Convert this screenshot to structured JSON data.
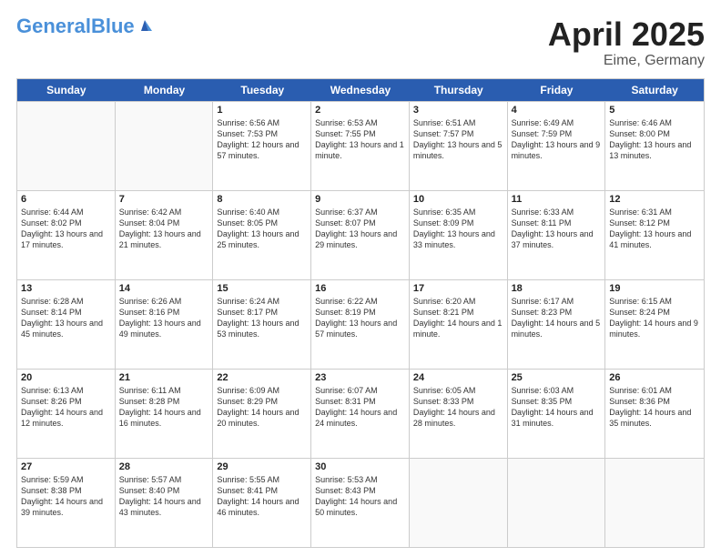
{
  "header": {
    "logo_general": "General",
    "logo_blue": "Blue",
    "title": "April 2025",
    "location": "Eime, Germany"
  },
  "weekdays": [
    "Sunday",
    "Monday",
    "Tuesday",
    "Wednesday",
    "Thursday",
    "Friday",
    "Saturday"
  ],
  "weeks": [
    [
      {
        "day": "",
        "sunrise": "",
        "sunset": "",
        "daylight": ""
      },
      {
        "day": "",
        "sunrise": "",
        "sunset": "",
        "daylight": ""
      },
      {
        "day": "1",
        "sunrise": "Sunrise: 6:56 AM",
        "sunset": "Sunset: 7:53 PM",
        "daylight": "Daylight: 12 hours and 57 minutes."
      },
      {
        "day": "2",
        "sunrise": "Sunrise: 6:53 AM",
        "sunset": "Sunset: 7:55 PM",
        "daylight": "Daylight: 13 hours and 1 minute."
      },
      {
        "day": "3",
        "sunrise": "Sunrise: 6:51 AM",
        "sunset": "Sunset: 7:57 PM",
        "daylight": "Daylight: 13 hours and 5 minutes."
      },
      {
        "day": "4",
        "sunrise": "Sunrise: 6:49 AM",
        "sunset": "Sunset: 7:59 PM",
        "daylight": "Daylight: 13 hours and 9 minutes."
      },
      {
        "day": "5",
        "sunrise": "Sunrise: 6:46 AM",
        "sunset": "Sunset: 8:00 PM",
        "daylight": "Daylight: 13 hours and 13 minutes."
      }
    ],
    [
      {
        "day": "6",
        "sunrise": "Sunrise: 6:44 AM",
        "sunset": "Sunset: 8:02 PM",
        "daylight": "Daylight: 13 hours and 17 minutes."
      },
      {
        "day": "7",
        "sunrise": "Sunrise: 6:42 AM",
        "sunset": "Sunset: 8:04 PM",
        "daylight": "Daylight: 13 hours and 21 minutes."
      },
      {
        "day": "8",
        "sunrise": "Sunrise: 6:40 AM",
        "sunset": "Sunset: 8:05 PM",
        "daylight": "Daylight: 13 hours and 25 minutes."
      },
      {
        "day": "9",
        "sunrise": "Sunrise: 6:37 AM",
        "sunset": "Sunset: 8:07 PM",
        "daylight": "Daylight: 13 hours and 29 minutes."
      },
      {
        "day": "10",
        "sunrise": "Sunrise: 6:35 AM",
        "sunset": "Sunset: 8:09 PM",
        "daylight": "Daylight: 13 hours and 33 minutes."
      },
      {
        "day": "11",
        "sunrise": "Sunrise: 6:33 AM",
        "sunset": "Sunset: 8:11 PM",
        "daylight": "Daylight: 13 hours and 37 minutes."
      },
      {
        "day": "12",
        "sunrise": "Sunrise: 6:31 AM",
        "sunset": "Sunset: 8:12 PM",
        "daylight": "Daylight: 13 hours and 41 minutes."
      }
    ],
    [
      {
        "day": "13",
        "sunrise": "Sunrise: 6:28 AM",
        "sunset": "Sunset: 8:14 PM",
        "daylight": "Daylight: 13 hours and 45 minutes."
      },
      {
        "day": "14",
        "sunrise": "Sunrise: 6:26 AM",
        "sunset": "Sunset: 8:16 PM",
        "daylight": "Daylight: 13 hours and 49 minutes."
      },
      {
        "day": "15",
        "sunrise": "Sunrise: 6:24 AM",
        "sunset": "Sunset: 8:17 PM",
        "daylight": "Daylight: 13 hours and 53 minutes."
      },
      {
        "day": "16",
        "sunrise": "Sunrise: 6:22 AM",
        "sunset": "Sunset: 8:19 PM",
        "daylight": "Daylight: 13 hours and 57 minutes."
      },
      {
        "day": "17",
        "sunrise": "Sunrise: 6:20 AM",
        "sunset": "Sunset: 8:21 PM",
        "daylight": "Daylight: 14 hours and 1 minute."
      },
      {
        "day": "18",
        "sunrise": "Sunrise: 6:17 AM",
        "sunset": "Sunset: 8:23 PM",
        "daylight": "Daylight: 14 hours and 5 minutes."
      },
      {
        "day": "19",
        "sunrise": "Sunrise: 6:15 AM",
        "sunset": "Sunset: 8:24 PM",
        "daylight": "Daylight: 14 hours and 9 minutes."
      }
    ],
    [
      {
        "day": "20",
        "sunrise": "Sunrise: 6:13 AM",
        "sunset": "Sunset: 8:26 PM",
        "daylight": "Daylight: 14 hours and 12 minutes."
      },
      {
        "day": "21",
        "sunrise": "Sunrise: 6:11 AM",
        "sunset": "Sunset: 8:28 PM",
        "daylight": "Daylight: 14 hours and 16 minutes."
      },
      {
        "day": "22",
        "sunrise": "Sunrise: 6:09 AM",
        "sunset": "Sunset: 8:29 PM",
        "daylight": "Daylight: 14 hours and 20 minutes."
      },
      {
        "day": "23",
        "sunrise": "Sunrise: 6:07 AM",
        "sunset": "Sunset: 8:31 PM",
        "daylight": "Daylight: 14 hours and 24 minutes."
      },
      {
        "day": "24",
        "sunrise": "Sunrise: 6:05 AM",
        "sunset": "Sunset: 8:33 PM",
        "daylight": "Daylight: 14 hours and 28 minutes."
      },
      {
        "day": "25",
        "sunrise": "Sunrise: 6:03 AM",
        "sunset": "Sunset: 8:35 PM",
        "daylight": "Daylight: 14 hours and 31 minutes."
      },
      {
        "day": "26",
        "sunrise": "Sunrise: 6:01 AM",
        "sunset": "Sunset: 8:36 PM",
        "daylight": "Daylight: 14 hours and 35 minutes."
      }
    ],
    [
      {
        "day": "27",
        "sunrise": "Sunrise: 5:59 AM",
        "sunset": "Sunset: 8:38 PM",
        "daylight": "Daylight: 14 hours and 39 minutes."
      },
      {
        "day": "28",
        "sunrise": "Sunrise: 5:57 AM",
        "sunset": "Sunset: 8:40 PM",
        "daylight": "Daylight: 14 hours and 43 minutes."
      },
      {
        "day": "29",
        "sunrise": "Sunrise: 5:55 AM",
        "sunset": "Sunset: 8:41 PM",
        "daylight": "Daylight: 14 hours and 46 minutes."
      },
      {
        "day": "30",
        "sunrise": "Sunrise: 5:53 AM",
        "sunset": "Sunset: 8:43 PM",
        "daylight": "Daylight: 14 hours and 50 minutes."
      },
      {
        "day": "",
        "sunrise": "",
        "sunset": "",
        "daylight": ""
      },
      {
        "day": "",
        "sunrise": "",
        "sunset": "",
        "daylight": ""
      },
      {
        "day": "",
        "sunrise": "",
        "sunset": "",
        "daylight": ""
      }
    ]
  ]
}
